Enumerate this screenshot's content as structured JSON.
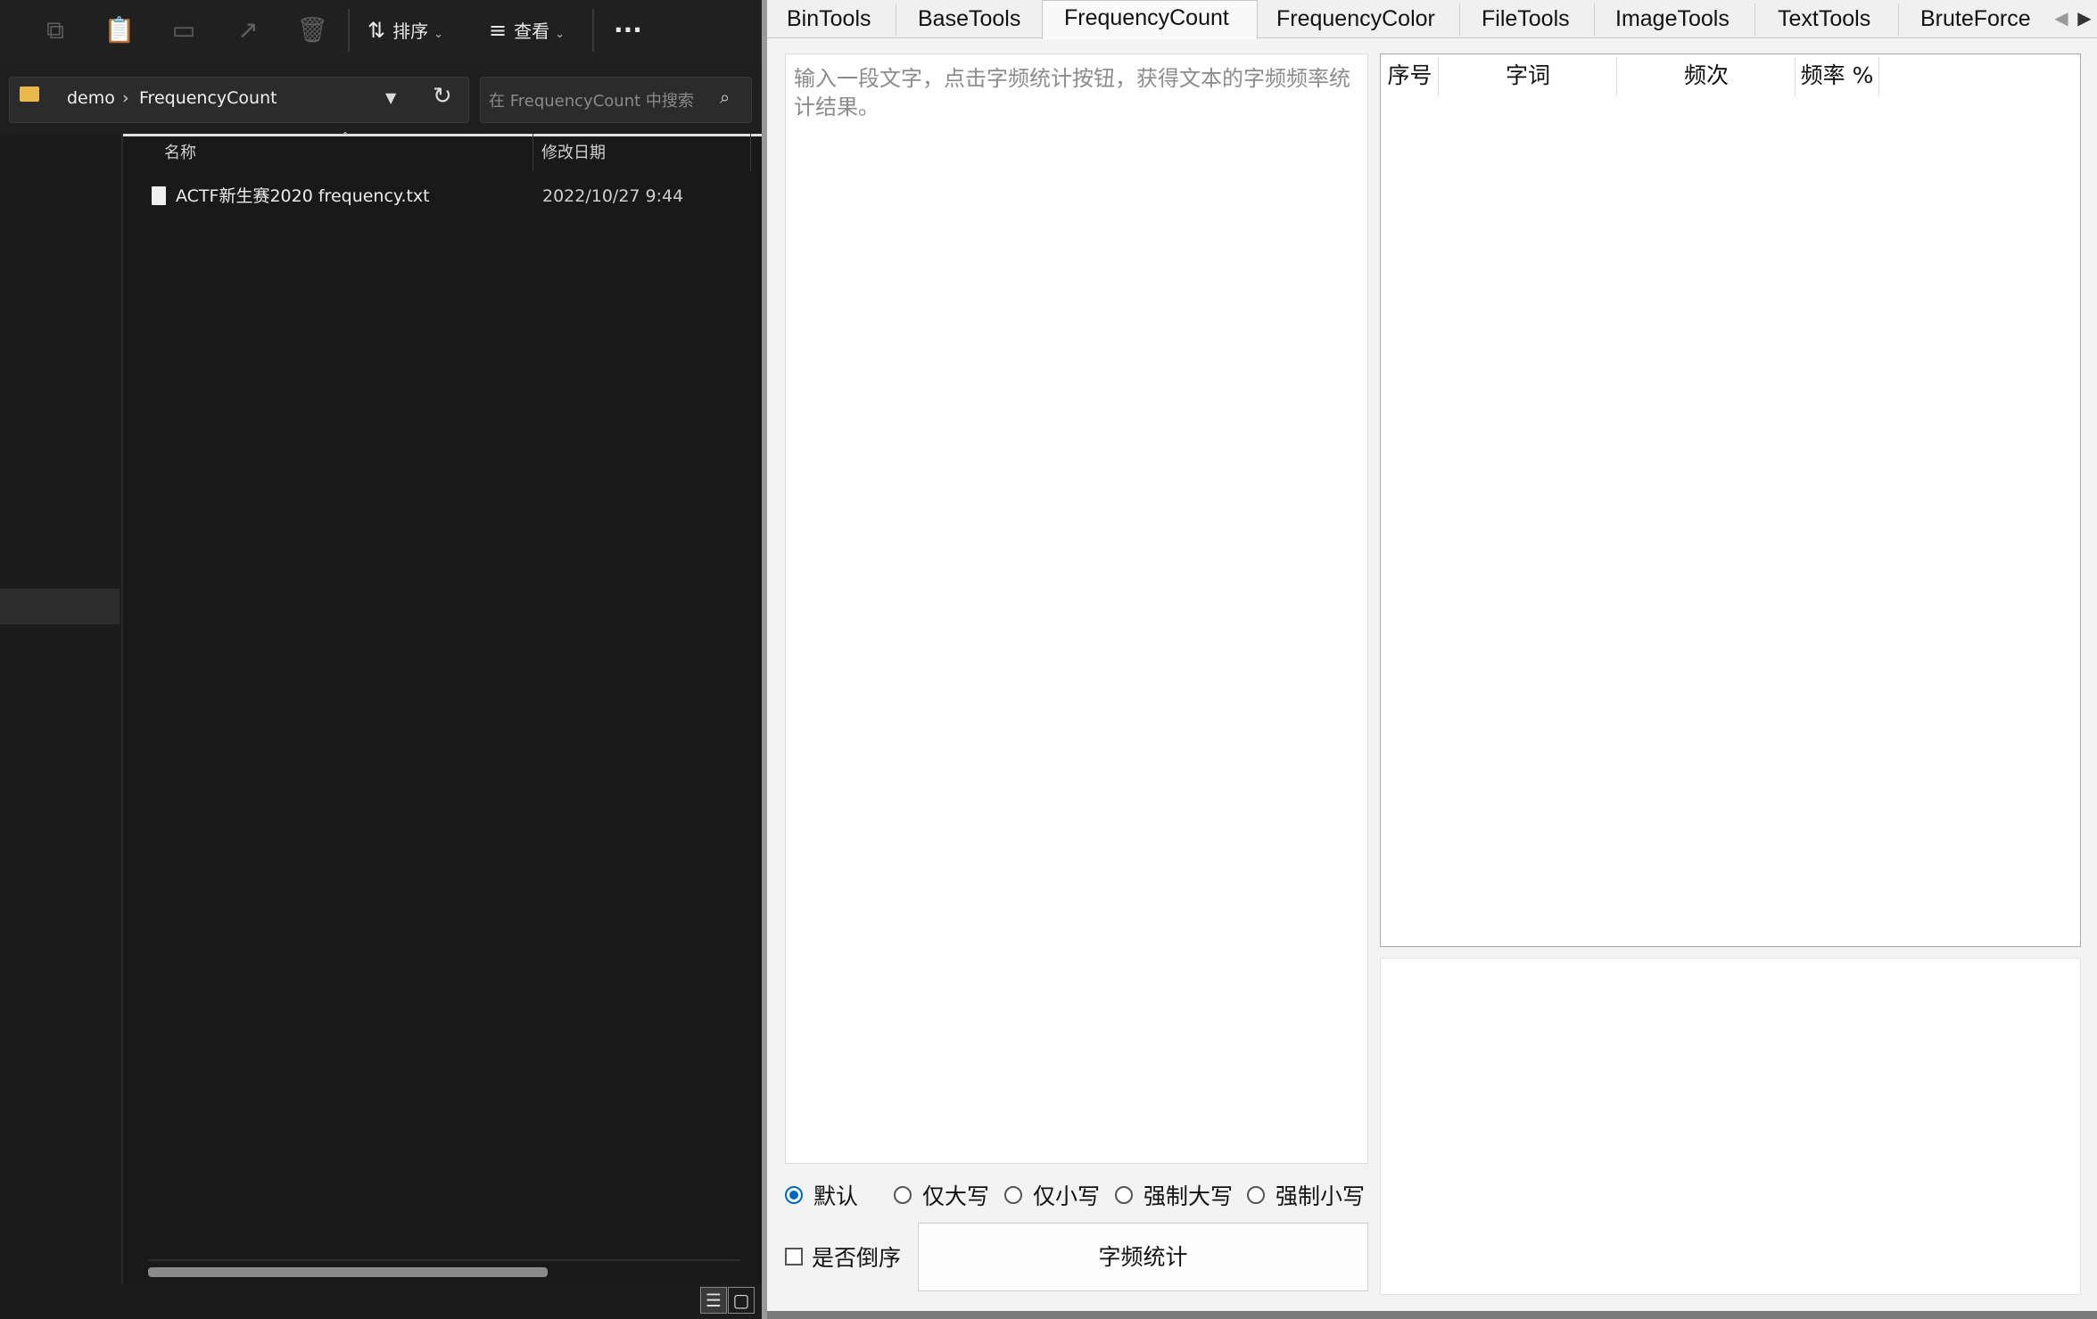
{
  "explorer": {
    "toolbar": {
      "sort_label": "排序",
      "view_label": "查看",
      "more_label": "···"
    },
    "address": {
      "path": [
        "demo",
        "FrequencyCount"
      ],
      "separator": "›",
      "search_placeholder": "在 FrequencyCount 中搜索"
    },
    "columns": {
      "name": "名称",
      "modified": "修改日期"
    },
    "files": [
      {
        "name": "ACTF新生赛2020 frequency.txt",
        "modified": "2022/10/27 9:44"
      }
    ]
  },
  "app": {
    "tabs": [
      {
        "label": "BinTools"
      },
      {
        "label": "BaseTools"
      },
      {
        "label": "FrequencyCount",
        "active": true
      },
      {
        "label": "FrequencyColor"
      },
      {
        "label": "FileTools"
      },
      {
        "label": "ImageTools"
      },
      {
        "label": "TextTools"
      },
      {
        "label": "BruteForce"
      }
    ],
    "input_placeholder": "输入一段文字，点击字频统计按钮，获得文本的字频频率统计结果。",
    "grid_headers": {
      "index": "序号",
      "word": "字词",
      "count": "频次",
      "rate": "频率 %"
    },
    "case_options": [
      {
        "label": "默认",
        "selected": true
      },
      {
        "label": "仅大写",
        "selected": false
      },
      {
        "label": "仅小写",
        "selected": false
      },
      {
        "label": "强制大写",
        "selected": false
      },
      {
        "label": "强制小写",
        "selected": false
      }
    ],
    "reverse_label": "是否倒序",
    "reverse_checked": false,
    "count_button": "字频统计"
  },
  "colors": {
    "accent": "#0067c0",
    "explorer_bg": "#191919",
    "app_bg": "#f3f3f3"
  }
}
